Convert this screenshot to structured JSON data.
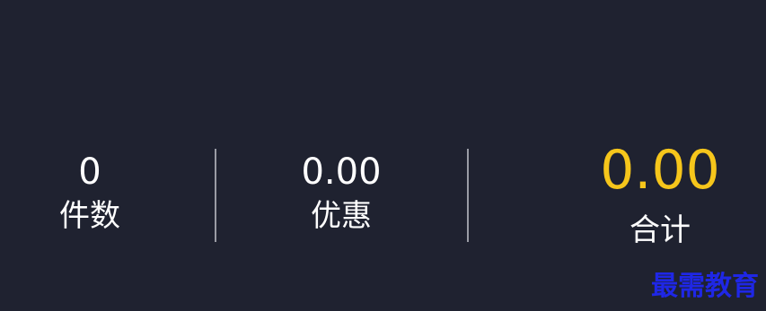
{
  "summary": {
    "quantity": {
      "value": "0",
      "label": "件数"
    },
    "discount": {
      "value": "0.00",
      "label": "优惠"
    },
    "total": {
      "value": "0.00",
      "label": "合计"
    }
  },
  "watermark": {
    "text": "最需教育"
  },
  "colors": {
    "background": "#1f2230",
    "text": "#ffffff",
    "total_accent": "#f6c61b",
    "divider": "#9a9ca5",
    "watermark": "#1f27e6"
  }
}
